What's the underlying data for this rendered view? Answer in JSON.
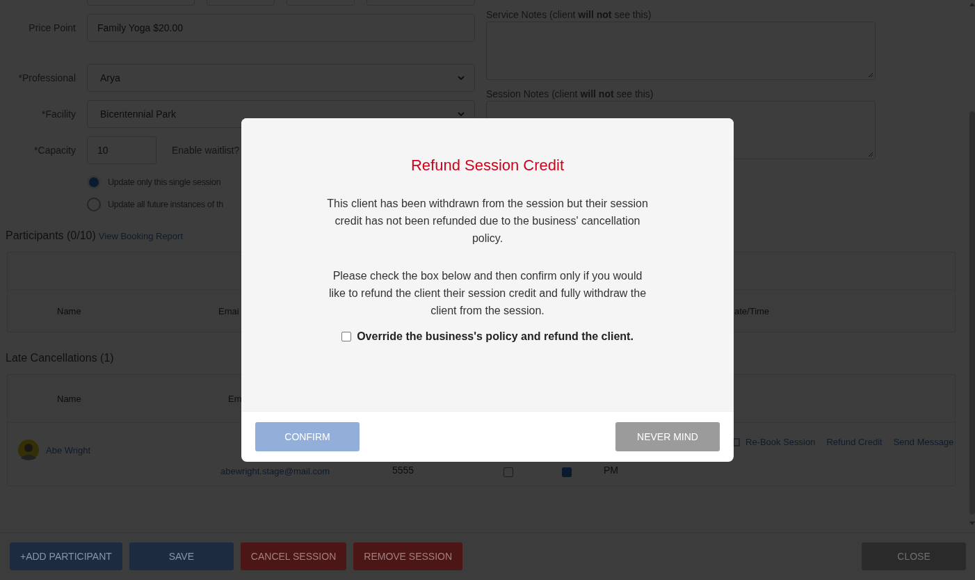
{
  "form": {
    "price_point": {
      "label": "Price Point",
      "value": "Family Yoga $20.00"
    },
    "professional": {
      "label": "*Professional",
      "value": "Arya"
    },
    "facility": {
      "label": "*Facility",
      "value": "Bicentennial Park"
    },
    "capacity": {
      "label": "*Capacity",
      "value": "10"
    },
    "waitlist": {
      "label": "Enable waitlist?"
    },
    "update_scope": [
      {
        "label": "Update only this single session",
        "selected": true
      },
      {
        "label": "Update all future instances of th",
        "selected": false
      }
    ]
  },
  "notes": [
    {
      "label": "Service Notes (client **will not** see this)"
    },
    {
      "label": "Session Notes (client **will not** see this)"
    }
  ],
  "participants": {
    "title": "Participants (0/10)",
    "link": "View Booking Report",
    "columns": [
      "Name",
      "Emai",
      "ate/Time"
    ]
  },
  "late_cancellations": {
    "title": "Late Cancellations (1)",
    "columns": [
      "Name",
      "Em"
    ],
    "rows": [
      {
        "name": "Abe Wright",
        "email": "abewright.stage@mail.com",
        "phone": "5555",
        "flag_1": false,
        "flag_2": true,
        "time": "PM",
        "actions": [
          "Re-Book Session",
          "Refund Credit",
          "Send Message"
        ]
      }
    ]
  },
  "footer_buttons": [
    {
      "label": "+ADD PARTICIPANT",
      "kind": "primary"
    },
    {
      "label": "SAVE",
      "kind": "primary"
    },
    {
      "label": "CANCEL SESSION",
      "kind": "danger"
    },
    {
      "label": "REMOVE SESSION",
      "kind": "danger"
    },
    {
      "label": "CLOSE",
      "kind": "close"
    }
  ],
  "modal": {
    "title": "Refund Session Credit",
    "paragraphs": [
      "This client has been withdrawn from the session but their session credit has not been refunded due to the business' cancellation policy.",
      "Please check the box below and then confirm only if you would like to refund the client their session credit and fully withdraw the client from the session."
    ],
    "override": {
      "label": "Override the business's policy and refund the client.",
      "checked": false
    },
    "confirm": {
      "label": "CONFIRM",
      "disabled": true
    },
    "cancel": {
      "label": "NEVER MIND"
    }
  }
}
